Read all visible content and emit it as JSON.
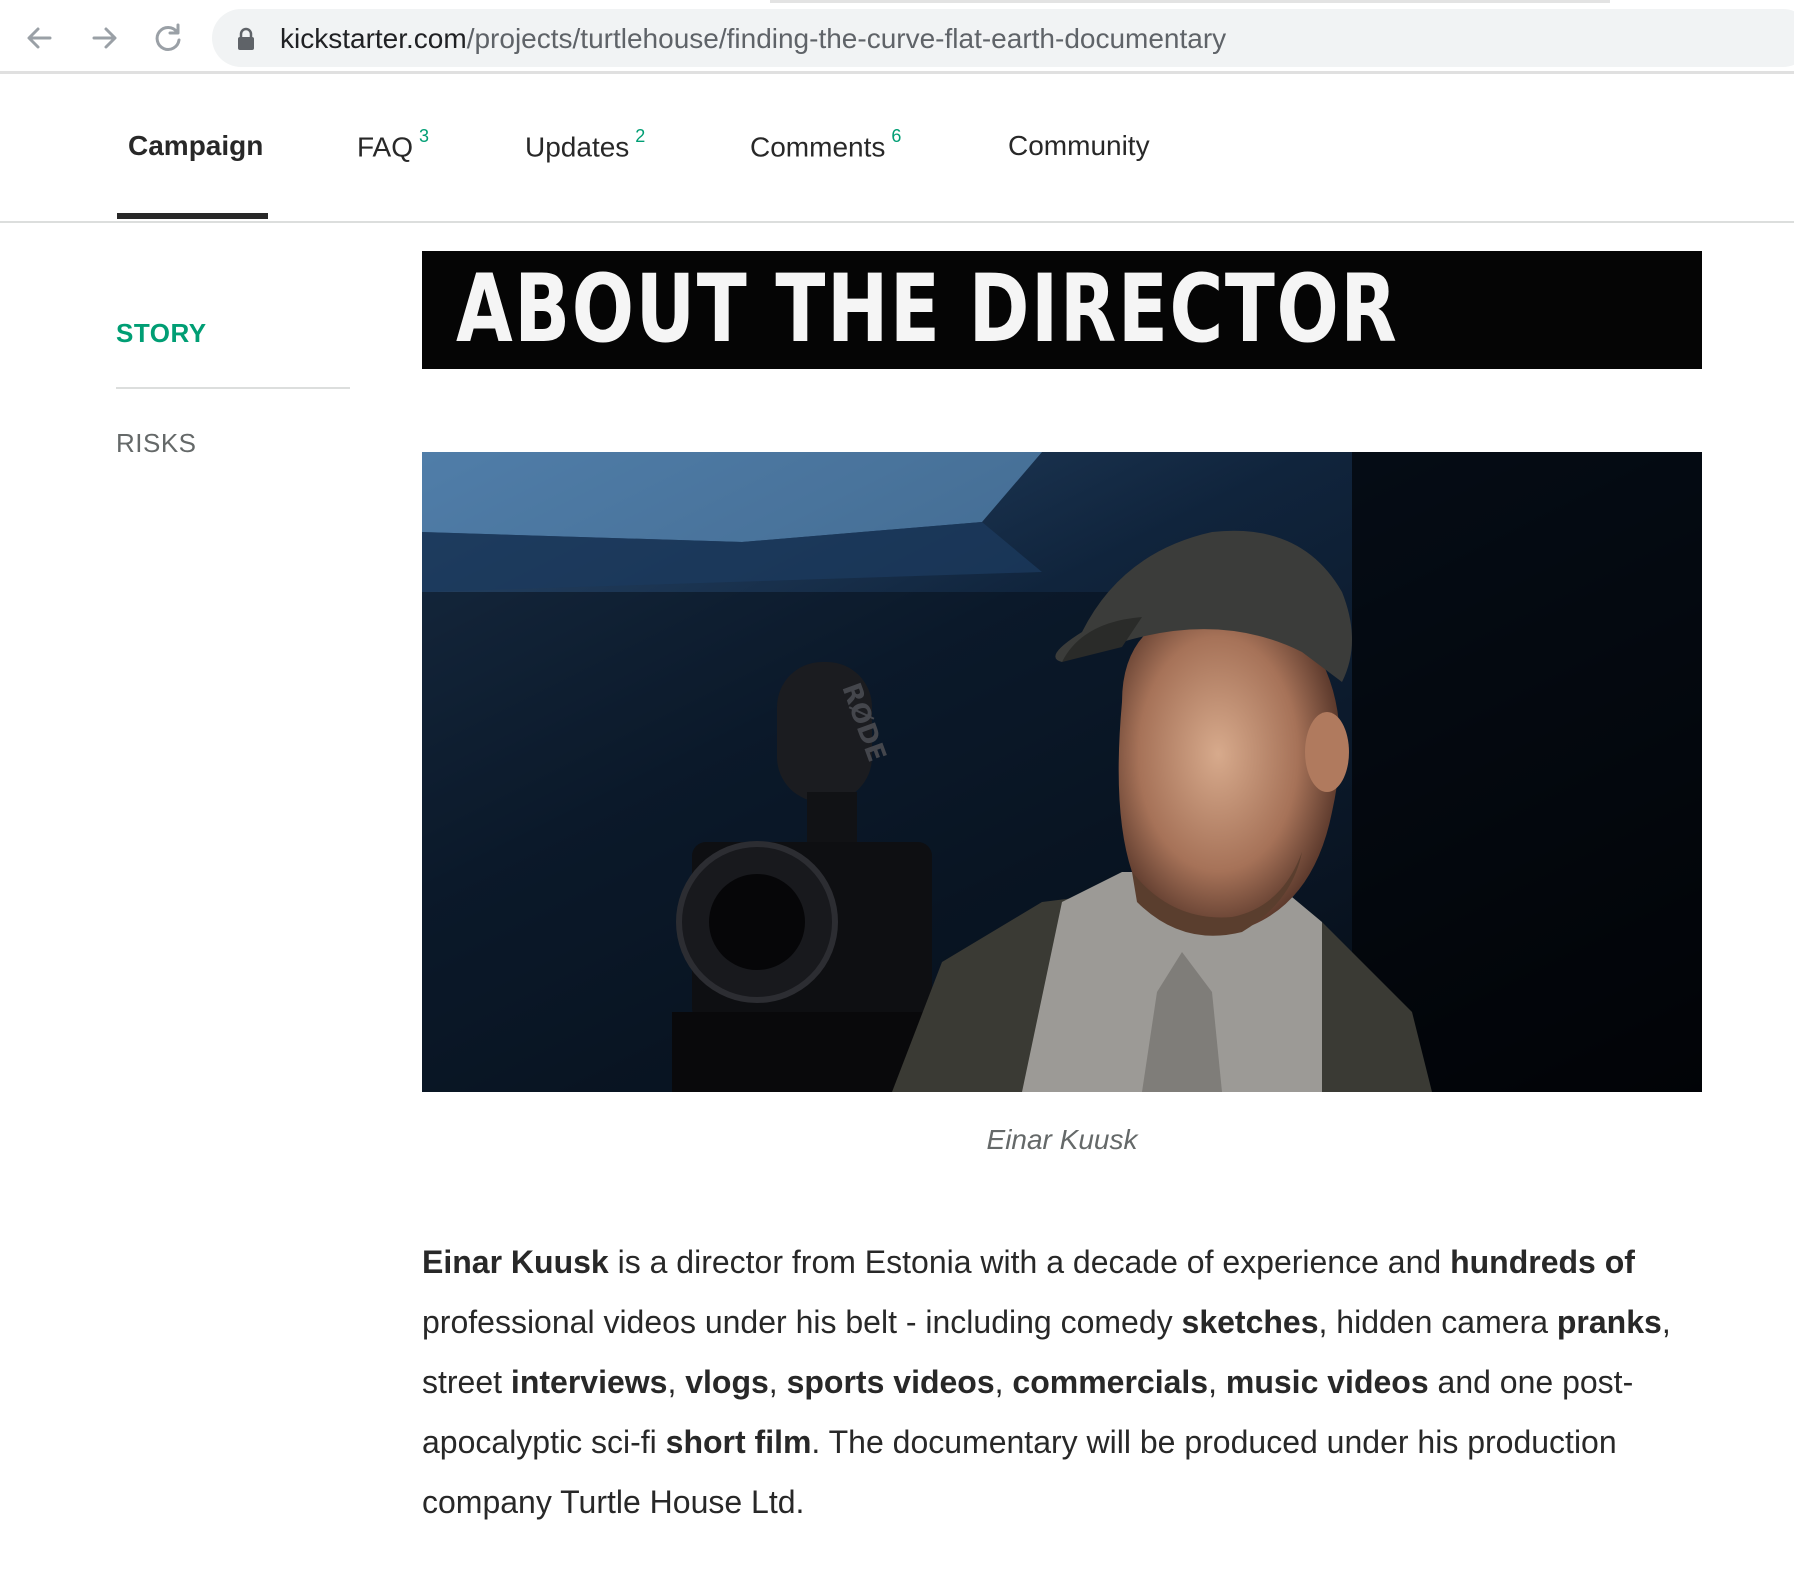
{
  "browser": {
    "back_icon": "arrow-left-icon",
    "forward_icon": "arrow-right-icon",
    "reload_icon": "reload-icon",
    "lock_icon": "lock-icon",
    "url_host": "kickstarter.com",
    "url_path": "/projects/turtlehouse/finding-the-curve-flat-earth-documentary"
  },
  "tabs": [
    {
      "label": "Campaign",
      "count": ""
    },
    {
      "label": "FAQ",
      "count": "3"
    },
    {
      "label": "Updates",
      "count": "2"
    },
    {
      "label": "Comments",
      "count": "6"
    },
    {
      "label": "Community",
      "count": ""
    }
  ],
  "colors": {
    "accent": "#009e74",
    "text": "#282828",
    "muted": "#656969"
  },
  "sidebar": {
    "items": [
      {
        "label": "STORY",
        "active": true
      },
      {
        "label": "RISKS",
        "active": false
      }
    ]
  },
  "content": {
    "banner_heading": "ABOUT THE DIRECTOR",
    "photo_mic_brand": "RØDE",
    "photo_caption": "Einar Kuusk",
    "paragraph": [
      {
        "text": "Einar Kuusk",
        "bold": true
      },
      {
        "text": " is a director from Estonia with a decade of experience and ",
        "bold": false
      },
      {
        "text": "hundreds of",
        "bold": true
      },
      {
        "text": " professional videos under his belt - including comedy ",
        "bold": false
      },
      {
        "text": "sketches",
        "bold": true
      },
      {
        "text": ", hidden camera ",
        "bold": false
      },
      {
        "text": "pranks",
        "bold": true
      },
      {
        "text": ", street ",
        "bold": false
      },
      {
        "text": "interviews",
        "bold": true
      },
      {
        "text": ", ",
        "bold": false
      },
      {
        "text": "vlogs",
        "bold": true
      },
      {
        "text": ", ",
        "bold": false
      },
      {
        "text": "sports videos",
        "bold": true
      },
      {
        "text": ", ",
        "bold": false
      },
      {
        "text": "commercials",
        "bold": true
      },
      {
        "text": ", ",
        "bold": false
      },
      {
        "text": "music videos",
        "bold": true
      },
      {
        "text": " and one post-apocalyptic sci-fi ",
        "bold": false
      },
      {
        "text": "short film",
        "bold": true
      },
      {
        "text": ". The documentary will be produced under his production company Turtle House Ltd.",
        "bold": false
      }
    ]
  }
}
